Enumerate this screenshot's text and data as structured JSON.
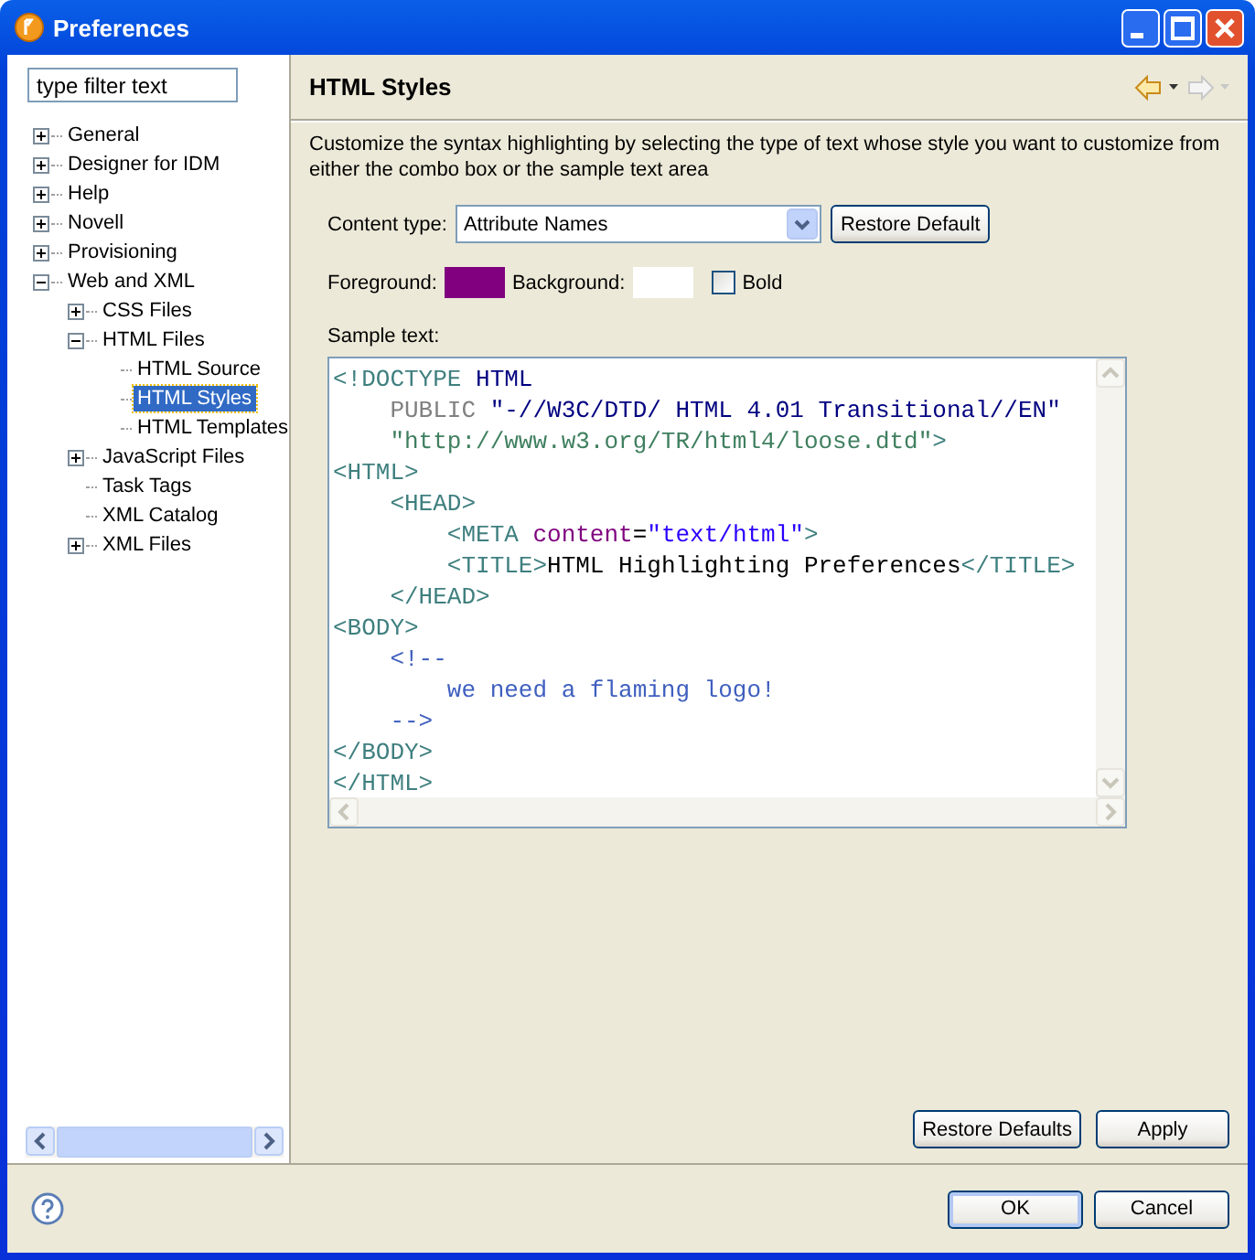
{
  "window": {
    "title": "Preferences"
  },
  "filter": {
    "placeholder": "type filter text"
  },
  "tree": [
    {
      "label": "General",
      "expanded": false,
      "selected": false
    },
    {
      "label": "Designer for IDM",
      "expanded": false,
      "selected": false
    },
    {
      "label": "Help",
      "expanded": false,
      "selected": false
    },
    {
      "label": "Novell",
      "expanded": false,
      "selected": false
    },
    {
      "label": "Provisioning",
      "expanded": false,
      "selected": false
    },
    {
      "label": "Web and XML",
      "expanded": true,
      "selected": false,
      "children": [
        {
          "label": "CSS Files",
          "expanded": false,
          "selected": false
        },
        {
          "label": "HTML Files",
          "expanded": true,
          "selected": false,
          "children": [
            {
              "label": "HTML Source",
              "selected": false
            },
            {
              "label": "HTML Styles",
              "selected": true
            },
            {
              "label": "HTML Templates",
              "selected": false
            }
          ]
        },
        {
          "label": "JavaScript Files",
          "expanded": false,
          "selected": false
        },
        {
          "label": "Task Tags",
          "selected": false
        },
        {
          "label": "XML Catalog",
          "selected": false
        },
        {
          "label": "XML Files",
          "expanded": false,
          "selected": false
        }
      ]
    }
  ],
  "page": {
    "title": "HTML Styles",
    "back_enabled": true,
    "forward_enabled": false,
    "description": "Customize the syntax highlighting by selecting the type of text whose style you want to customize from either the combo box or the sample text area",
    "content_type_label": "Content type:",
    "content_type": "Attribute Names",
    "restore_default": "Restore Default",
    "foreground_label": "Foreground:",
    "foreground": {
      "color": "#800080"
    },
    "background_label": "Background:",
    "background": {
      "color": "#ffffff"
    },
    "bold": {
      "label": "Bold",
      "checked": false
    },
    "sample_label": "Sample text:",
    "sample": [
      [
        {
          "kind": "tag",
          "text": "<!DOCTYPE "
        },
        {
          "kind": "doctype",
          "text": "HTML"
        }
      ],
      [
        {
          "kind": "keyword",
          "text": "    PUBLIC "
        },
        {
          "kind": "doctype",
          "text": "\"-//W3C/DTD/ HTML 4.01 Transitional//EN\""
        }
      ],
      [
        {
          "kind": "sysid",
          "text": "    \"http://www.w3.org/TR/html4/loose.dtd\""
        },
        {
          "kind": "tag",
          "text": ">"
        }
      ],
      [
        {
          "kind": "tag",
          "text": "<HTML>"
        }
      ],
      [
        {
          "kind": "tag",
          "text": "    <HEAD>"
        }
      ],
      [
        {
          "kind": "tag",
          "text": "        <META "
        },
        {
          "kind": "attr",
          "text": "content"
        },
        {
          "kind": "plain",
          "text": "="
        },
        {
          "kind": "value",
          "text": "\"text/html\""
        },
        {
          "kind": "tag",
          "text": ">"
        }
      ],
      [
        {
          "kind": "tag",
          "text": "        <TITLE>"
        },
        {
          "kind": "plain",
          "text": "HTML Highlighting Preferences"
        },
        {
          "kind": "tag",
          "text": "</TITLE>"
        }
      ],
      [
        {
          "kind": "tag",
          "text": "    </HEAD>"
        }
      ],
      [
        {
          "kind": "tag",
          "text": "<BODY>"
        }
      ],
      [
        {
          "kind": "comment",
          "text": "    <!--"
        }
      ],
      [
        {
          "kind": "comment",
          "text": "        we need a flaming logo!"
        }
      ],
      [
        {
          "kind": "comment",
          "text": "    -->"
        }
      ],
      [
        {
          "kind": "tag",
          "text": "</BODY>"
        }
      ],
      [
        {
          "kind": "tag",
          "text": "</HTML>"
        }
      ]
    ]
  },
  "page_buttons": [
    "Restore Defaults",
    "Apply"
  ],
  "dialog_buttons": [
    {
      "label": "OK",
      "default": true
    },
    {
      "label": "Cancel",
      "default": false
    }
  ]
}
